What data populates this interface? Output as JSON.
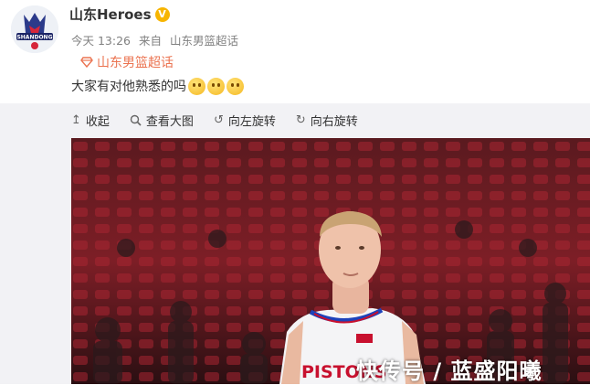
{
  "post": {
    "username": "山东Heroes",
    "verified_badge": "V",
    "time": "今天 13:26",
    "source_prefix": "来自",
    "source": "山东男篮超话",
    "topic": "山东男篮超话",
    "text": "大家有对他熟悉的吗",
    "emoji_count": 3
  },
  "avatar_text": "SHANDONG",
  "toolbar": [
    {
      "icon": "collapse-icon",
      "label": "收起"
    },
    {
      "icon": "zoom-icon",
      "label": "查看大图"
    },
    {
      "icon": "rotate-left-icon",
      "label": "向左旋转"
    },
    {
      "icon": "rotate-right-icon",
      "label": "向右旋转"
    }
  ],
  "photo": {
    "jersey_text": "PISTONS",
    "watermark": "快传号 / 蓝盛阳曦"
  },
  "colors": {
    "accent": "#eb7350",
    "badge": "#f7b500",
    "jersey_blue": "#1d42ba",
    "jersey_red": "#c8102e"
  }
}
